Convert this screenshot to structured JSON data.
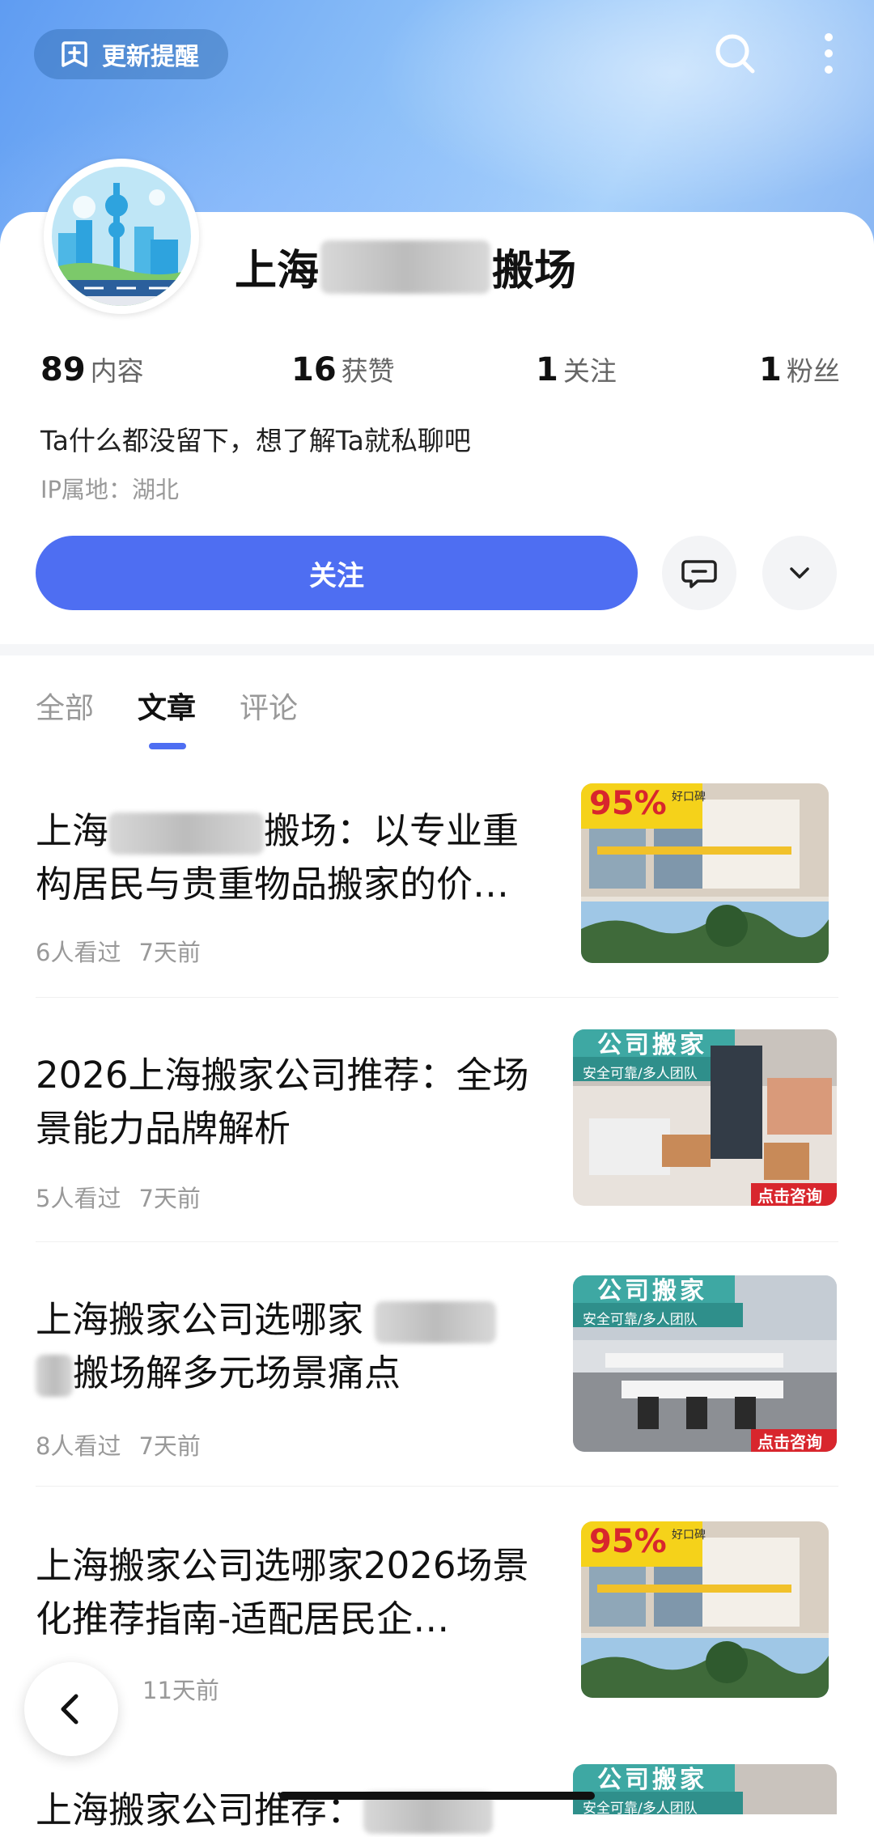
{
  "header": {
    "update_label": "更新提醒",
    "icons": {
      "update": "bell-plus-icon",
      "search": "search-icon",
      "more": "more-vertical-icon"
    }
  },
  "profile": {
    "name_prefix": "上海",
    "name_suffix": "搬场",
    "stats": [
      {
        "num": "89",
        "label": "内容"
      },
      {
        "num": "16",
        "label": "获赞"
      },
      {
        "num": "1",
        "label": "关注"
      },
      {
        "num": "1",
        "label": "粉丝"
      }
    ],
    "bio": "Ta什么都没留下，想了解Ta就私聊吧",
    "ip": "IP属地：湖北",
    "follow_label": "关注"
  },
  "tabs": [
    {
      "label": "全部",
      "active": false
    },
    {
      "label": "文章",
      "active": true
    },
    {
      "label": "评论",
      "active": false
    }
  ],
  "articles": [
    {
      "title_a": "上海",
      "title_b": "搬场：以专业重构居民与贵重物品搬家的价…",
      "views": "6人看过",
      "time": "7天前",
      "thumb": {
        "badge": "95%",
        "badge_sub": "好口碑"
      }
    },
    {
      "title": "2026上海搬家公司推荐：全场景能力品牌解析",
      "views": "5人看过",
      "time": "7天前",
      "thumb": {
        "banner": "公司搬家",
        "sub": "安全可靠/多人团队",
        "cta": "点击咨询"
      }
    },
    {
      "title_a": "上海搬家公司选哪家",
      "title_b": "搬场解多元场景痛点",
      "views": "8人看过",
      "time": "7天前",
      "thumb": {
        "banner": "公司搬家",
        "sub": "安全可靠/多人团队",
        "cta": "点击咨询"
      }
    },
    {
      "title": "上海搬家公司选哪家2026场景化推荐指南-适配居民企…",
      "views": "",
      "time": "11天前",
      "thumb": {
        "badge": "95%",
        "badge_sub": "好口碑"
      }
    },
    {
      "title_a": "上海搬家公司推荐：",
      "thumb": {
        "banner": "公司搬家",
        "sub": "安全可靠/多人团队"
      }
    }
  ],
  "colors": {
    "accent": "#4e6ef2",
    "banner": "#8dc0f8",
    "badge": "#f5d21a",
    "cta": "#d8262d"
  }
}
